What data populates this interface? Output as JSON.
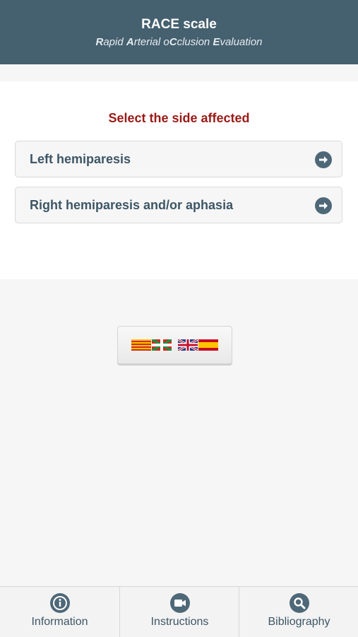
{
  "header": {
    "title": "RACE scale",
    "subtitle": {
      "p1": "R",
      "p2": "apid ",
      "p3": "A",
      "p4": "rterial o",
      "p5": "C",
      "p6": "clusion ",
      "p7": "E",
      "p8": "valuation"
    }
  },
  "main": {
    "prompt": "Select the side affected",
    "options": [
      {
        "label": "Left hemiparesis",
        "icon": "arrow-right-circle-icon"
      },
      {
        "label": "Right hemiparesis and/or aphasia",
        "icon": "arrow-right-circle-icon"
      }
    ]
  },
  "language": {
    "flags": [
      "catalan-flag",
      "basque-flag",
      "uk-flag",
      "spanish-flag"
    ]
  },
  "tabbar": {
    "tabs": [
      {
        "label": "Information",
        "icon": "info-icon"
      },
      {
        "label": "Instructions",
        "icon": "video-camera-icon"
      },
      {
        "label": "Bibliography",
        "icon": "search-icon"
      }
    ]
  },
  "colors": {
    "header_bg": "#45606f",
    "prompt_text": "#9a1a15",
    "option_text": "#3d5666",
    "icon_fill": "#4e6878"
  }
}
